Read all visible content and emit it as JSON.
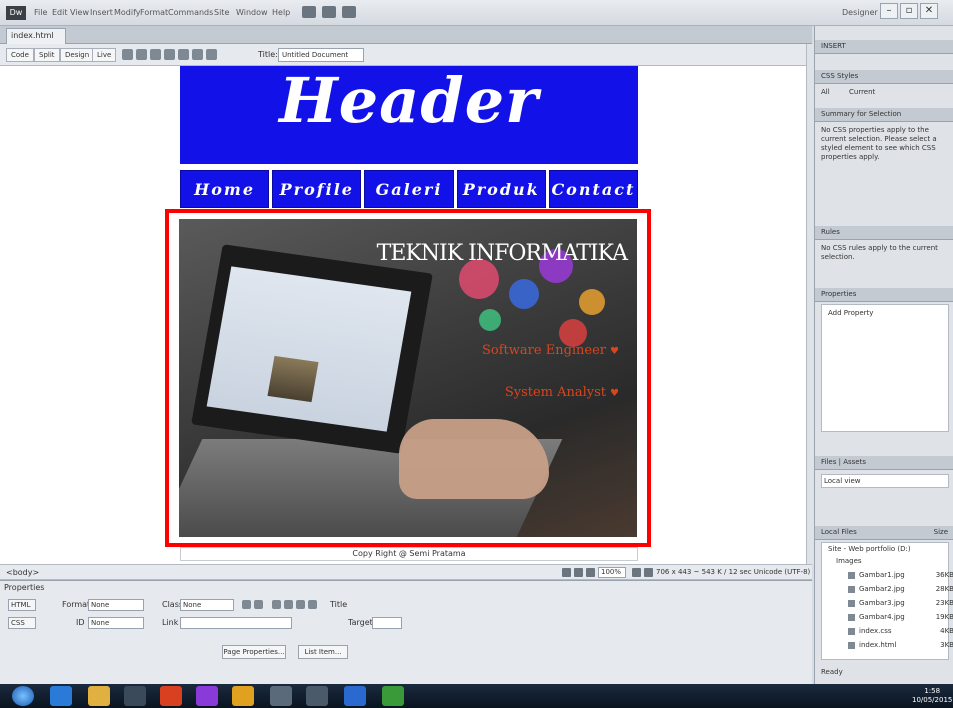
{
  "app": {
    "menu": [
      "File",
      "Edit",
      "View",
      "Insert",
      "Modify",
      "Format",
      "Commands",
      "Site",
      "Window",
      "Help"
    ],
    "workspace": "Designer",
    "window_controls": {
      "minimize": "–",
      "restore": "▫",
      "close": "✕"
    }
  },
  "document": {
    "tab_label": "index.html",
    "views": {
      "code": "Code",
      "split": "Split",
      "design": "Design",
      "live": "Live"
    },
    "title_label": "Title:",
    "title_value": "Untitled Document"
  },
  "page": {
    "header": "Header",
    "nav": [
      "Home",
      "Profile",
      "Galeri",
      "Produk",
      "Contact"
    ],
    "hero_title": "TEKNIK INFORMATIKA",
    "hero_links": [
      "Software Engineer",
      "System Analyst"
    ],
    "footer": "Copy Right @ Semi Pratama"
  },
  "status": {
    "tag": "<body>",
    "zoom": "100%",
    "info": "706 x 443 ~ 543 K / 12 sec Unicode (UTF-8)"
  },
  "properties": {
    "title": "Properties",
    "html_btn": "HTML",
    "css_btn": "CSS",
    "format_label": "Format",
    "format_value": "None",
    "class_label": "Class",
    "class_value": "None",
    "id_label": "ID",
    "id_value": "None",
    "link_label": "Link",
    "title_field_label": "Title",
    "target_label": "Target",
    "page_properties": "Page Properties...",
    "list_item": "List Item..."
  },
  "right_panel": {
    "insert_head": "INSERT",
    "css_styles_head": "CSS Styles",
    "css_tabs": [
      "All",
      "Current"
    ],
    "summary_head": "Summary for Selection",
    "summary_text": "No CSS properties apply to the current selection. Please select a styled element to see which CSS properties apply.",
    "rules_head": "Rules",
    "rules_text": "No CSS rules apply to the current selection.",
    "properties_head": "Properties",
    "add_property": "Add Property",
    "files_head": "Files",
    "assets_head": "Assets",
    "site_select": "Local view",
    "local_files_head": "Local Files",
    "size_head": "Size",
    "site_root": "Site - Web portfolio (D:)",
    "folder": "Images",
    "files": [
      {
        "name": "Gambar1.jpg",
        "size": "36KB"
      },
      {
        "name": "Gambar2.jpg",
        "size": "28KB"
      },
      {
        "name": "Gambar3.jpg",
        "size": "23KB"
      },
      {
        "name": "Gambar4.jpg",
        "size": "19KB"
      },
      {
        "name": "index.css",
        "size": "4KB"
      },
      {
        "name": "index.html",
        "size": "3KB"
      }
    ],
    "ready": "Ready"
  },
  "taskbar": {
    "time": "1:58",
    "date": "10/05/2015"
  },
  "colors": {
    "banner_blue": "#1212e8",
    "highlight_red": "#ff0000",
    "hero_link": "#d8461e"
  }
}
